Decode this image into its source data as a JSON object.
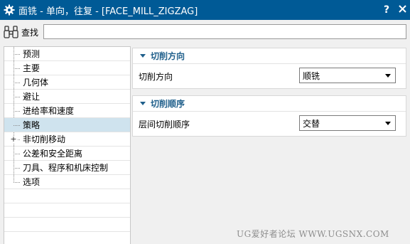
{
  "window": {
    "title": "面铣 - 单向，往复 - [FACE_MILL_ZIGZAG]",
    "help_label": "?",
    "close_label": "X",
    "titlebar_color": "#005a96"
  },
  "find": {
    "label": "查找",
    "value": "",
    "placeholder": ""
  },
  "tree": {
    "items": [
      {
        "label": "预测"
      },
      {
        "label": "主要"
      },
      {
        "label": "几何体"
      },
      {
        "label": "避让"
      },
      {
        "label": "进给率和速度"
      },
      {
        "label": "策略"
      },
      {
        "label": "非切削移动",
        "expander": "+"
      },
      {
        "label": "公差和安全距离"
      },
      {
        "label": "刀具、程序和机床控制"
      },
      {
        "label": "选项"
      }
    ],
    "selected_label": "策略",
    "selected_color": "#cfe3ee"
  },
  "groups": {
    "cut_direction": {
      "title": "切削方向",
      "field_label": "切削方向",
      "value": "顺铣"
    },
    "cut_order": {
      "title": "切削顺序",
      "field_label": "层间切削顺序",
      "value": "交替"
    }
  },
  "watermark": "UG爱好者论坛 WWW.UGSNX.COM"
}
